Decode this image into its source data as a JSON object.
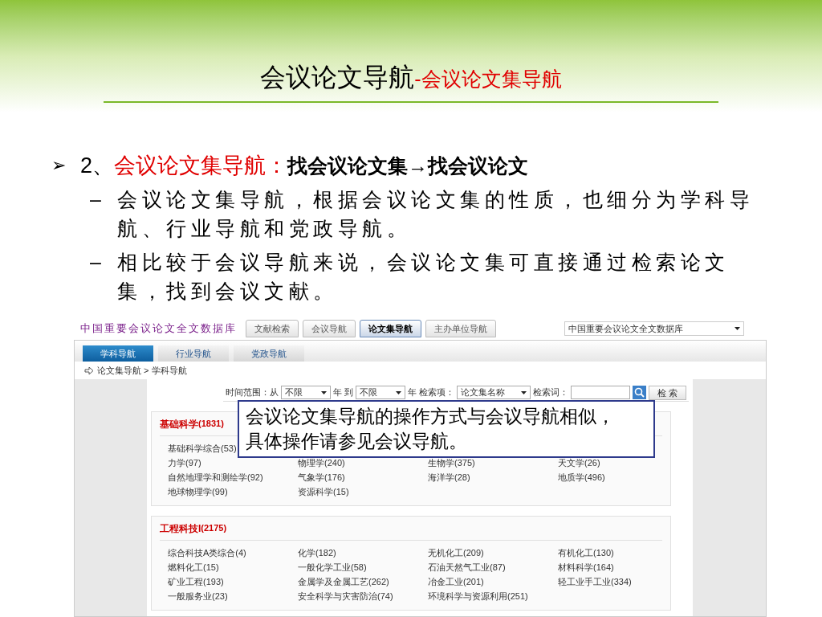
{
  "slide": {
    "title": "会议论文导航",
    "title_sub": "-会议论文集导航",
    "bullet": {
      "marker": "➢",
      "number": "2、",
      "highlight": "会议论文集导航：",
      "rest": "找会议论文集→找会议论文"
    },
    "sub_bullets": [
      {
        "marker": "–",
        "text": "会议论文集导航，根据会议论文集的性质，也细分为学科导航、行业导航和党政导航。"
      },
      {
        "marker": "–",
        "text": "相比较于会议导航来说，会议论文集可直接通过检索论文集，找到会议文献。"
      }
    ]
  },
  "screenshot": {
    "db_title": "中国重要会议论文全文数据库",
    "top_tabs": [
      {
        "label": "文献检索",
        "selected": false
      },
      {
        "label": "会议导航",
        "selected": false
      },
      {
        "label": "论文集导航",
        "selected": true
      },
      {
        "label": "主办单位导航",
        "selected": false
      }
    ],
    "db_select": "中国重要会议论文全文数据库",
    "sub_tabs": [
      {
        "label": "学科导航",
        "selected": true
      },
      {
        "label": "行业导航",
        "selected": false
      },
      {
        "label": "党政导航",
        "selected": false
      }
    ],
    "breadcrumb": "论文集导航 > 学科导航",
    "search": {
      "from_label": "时间范围：从",
      "from_value": "不限",
      "to_label": "年 到",
      "to_value": "不限",
      "field_label": "年 检索项：",
      "field_value": "论文集名称",
      "term_label": "检索词：",
      "button": "检 索"
    },
    "sections": [
      {
        "title": "基础科学",
        "count": "(1831)",
        "rows": [
          [
            "基础科学综合(53)"
          ],
          [
            "力学(97)",
            "物理学(240)",
            "生物学(375)",
            "天文学(26)"
          ],
          [
            "自然地理学和测绘学(92)",
            "气象学(176)",
            "海洋学(28)",
            "地质学(496)"
          ],
          [
            "地球物理学(99)",
            "资源科学(15)"
          ]
        ]
      },
      {
        "title": "工程科技I",
        "count": "(2175)",
        "rows": [
          [
            "综合科技A类综合(4)",
            "化学(182)",
            "无机化工(209)",
            "有机化工(130)"
          ],
          [
            "燃料化工(15)",
            "一般化学工业(58)",
            "石油天然气工业(87)",
            "材料科学(164)"
          ],
          [
            "矿业工程(193)",
            "金属学及金属工艺(262)",
            "冶金工业(201)",
            "轻工业手工业(334)"
          ],
          [
            "一般服务业(23)",
            "安全科学与灾害防治(74)",
            "环境科学与资源利用(251)"
          ]
        ]
      }
    ]
  },
  "callout": "会议论文集导航的操作方式与会议导航相似，具体操作请参见会议导航。"
}
